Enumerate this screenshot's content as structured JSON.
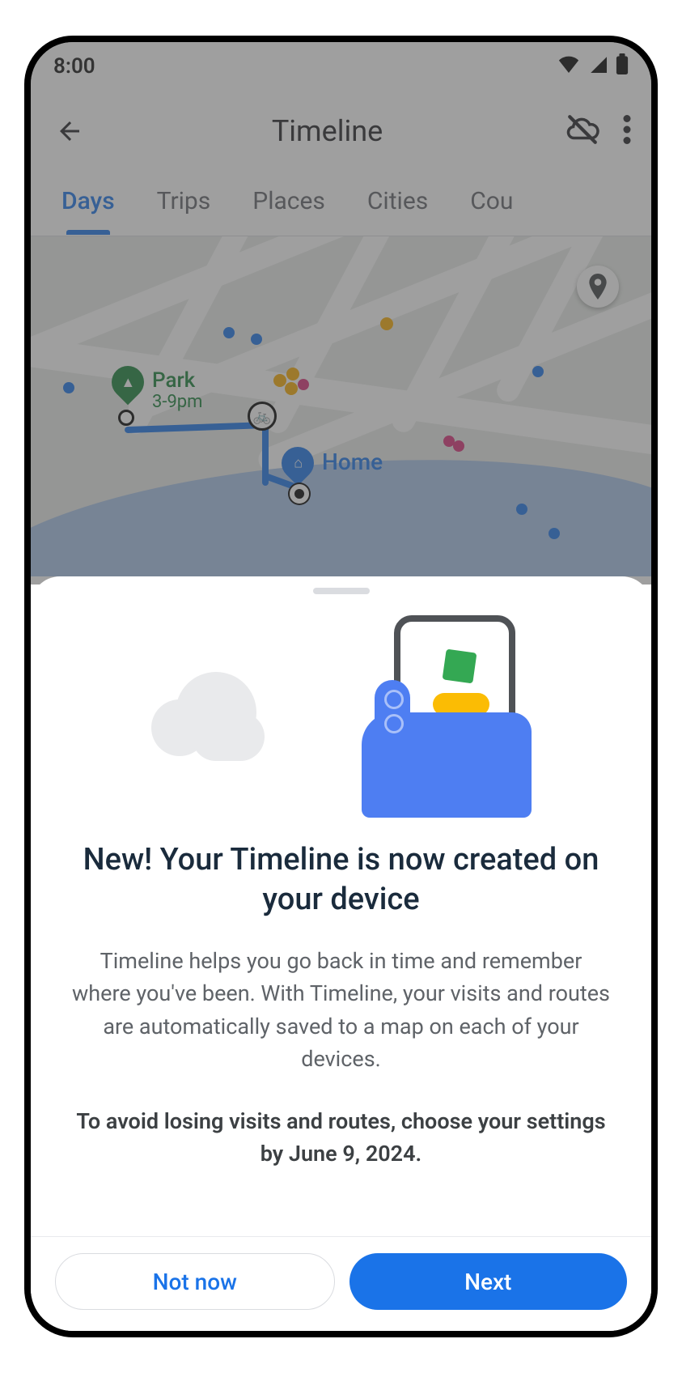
{
  "status_bar": {
    "time": "8:00"
  },
  "header": {
    "title": "Timeline"
  },
  "tabs": {
    "items": [
      {
        "label": "Days",
        "active": true
      },
      {
        "label": "Trips",
        "active": false
      },
      {
        "label": "Places",
        "active": false
      },
      {
        "label": "Cities",
        "active": false
      },
      {
        "label": "Cou",
        "active": false
      }
    ]
  },
  "map": {
    "places": {
      "park": {
        "name": "Park",
        "hours": "3-9pm"
      },
      "home": {
        "name": "Home"
      }
    }
  },
  "sheet": {
    "title": "New! Your Timeline is now created on your device",
    "description": "Timeline helps you go back in time and remember where you've been.  With Timeline, your visits and routes are automatically saved to a map on each of your devices.",
    "warning": "To avoid losing visits and routes, choose your settings by June 9, 2024.",
    "buttons": {
      "secondary": "Not now",
      "primary": "Next"
    }
  }
}
